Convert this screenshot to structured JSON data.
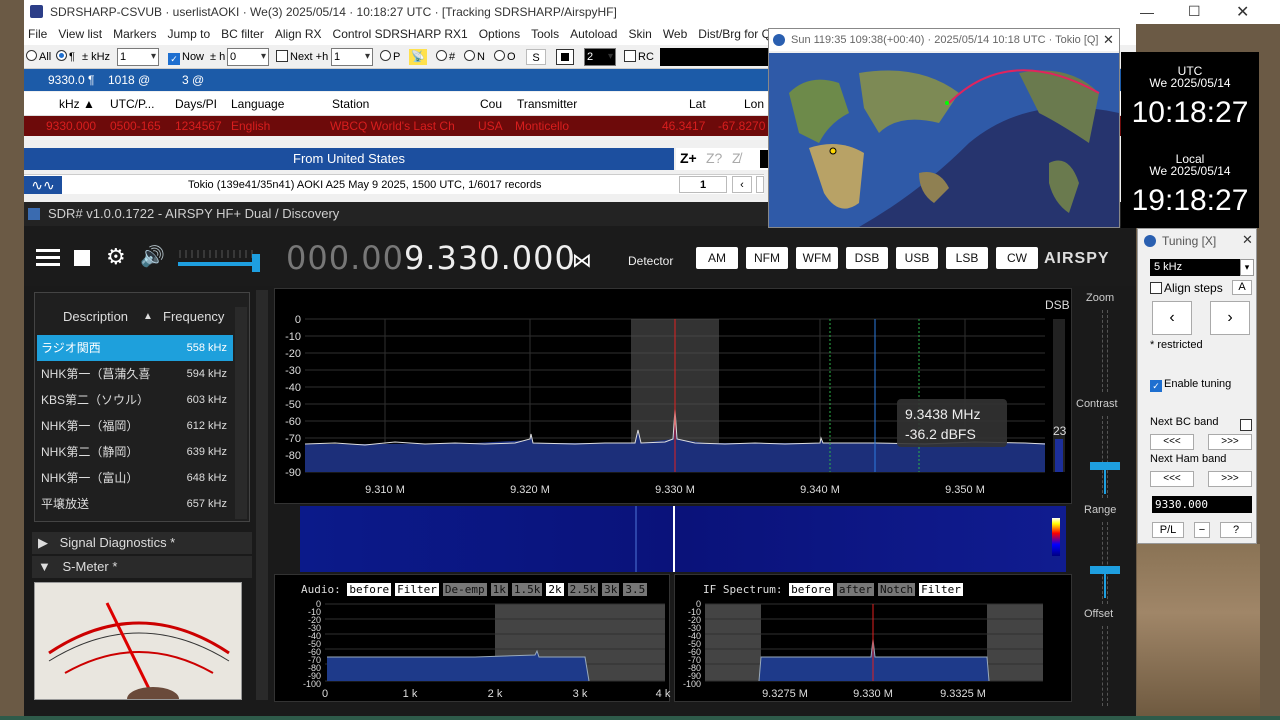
{
  "main": {
    "title": "SDRSHARP-CSVUB · userlistAOKI · We(3) 2025/05/14 · 10:18:27 UTC · [Tracking SDRSHARP/AirspyHF]"
  },
  "menu": [
    "File",
    "View list",
    "Markers",
    "Jump to",
    "BC filter",
    "Align RX",
    "Control SDRSHARP RX1",
    "Options",
    "Tools",
    "Autoload",
    "Skin",
    "Web",
    "Dist/Brg for Q"
  ],
  "controls": {
    "all": "All",
    "pilcrow": "¶",
    "pm_khz": "± kHz",
    "sel1": "1",
    "now": "Now",
    "pm_h": "± h",
    "sel2": "0",
    "next": "Next +h",
    "sel3": "1",
    "p": "P",
    "hash": "#",
    "n": "N",
    "o": "O",
    "s": "S",
    "num": "2",
    "rc": "RC"
  },
  "freqrow": {
    "freq": "9330.0 ¶",
    "count": "1018 @",
    "count2": "3 @"
  },
  "table": {
    "headers": [
      "kHz ▲",
      "UTC/P...",
      "Days/PI",
      "Language",
      "Station",
      "Cou",
      "Transmitter",
      "Lat",
      "Lon"
    ],
    "row": [
      "9330.000",
      "0500-165",
      "1234567",
      "English",
      "WBCQ World's Last Ch",
      "USA",
      "Monticello",
      "46.3417",
      "-67.8270"
    ]
  },
  "from": "From United States",
  "tokio": {
    "info": "Tokio (139e41/35n41) AOKI A25 May 9 2025, 1500 UTC, 1/6017 records",
    "page": "1"
  },
  "sdr": {
    "title": "SDR# v1.0.0.1722 - AIRSPY HF+ Dual / Discovery",
    "freq_dim": "000.00",
    "freq_main": "9.330.000",
    "detector": "Detector",
    "modes": [
      "AM",
      "NFM",
      "WFM",
      "DSB",
      "USB",
      "LSB",
      "CW"
    ],
    "logo": "AIRSPY",
    "list_headers": {
      "desc": "Description",
      "freq": "Frequency"
    },
    "list": [
      [
        "ラジオ関西",
        "558 kHz"
      ],
      [
        "NHK第一（菖蒲久喜",
        "594 kHz"
      ],
      [
        "KBS第二（ソウル）",
        "603 kHz"
      ],
      [
        "NHK第一（福岡）",
        "612 kHz"
      ],
      [
        "NHK第二（静岡）",
        "639 kHz"
      ],
      [
        "NHK第一（富山）",
        "648 kHz"
      ],
      [
        "平壌放送",
        "657 kHz"
      ]
    ],
    "sig_diag": "Signal Diagnostics *",
    "smeter": "S-Meter *",
    "dsb": "DSB",
    "level": "23",
    "tooltip": [
      "9.3438 MHz",
      "-36.2 dBFS"
    ],
    "yaxis": [
      "0",
      "-10",
      "-20",
      "-30",
      "-40",
      "-50",
      "-60",
      "-70",
      "-80",
      "-90"
    ],
    "xaxis": [
      "9.310 M",
      "9.320 M",
      "9.330 M",
      "9.340 M",
      "9.350 M"
    ],
    "zoom": "Zoom",
    "contrast": "Contrast",
    "range": "Range",
    "offset": "Offset",
    "audio": {
      "label": "Audio:",
      "chips": [
        "before",
        "Filter",
        "De-emp",
        "1k",
        "1.5k",
        "2k",
        "2.5k",
        "3k",
        "3.5"
      ],
      "x": [
        "0",
        "1 k",
        "2 k",
        "3 k",
        "4 k"
      ]
    },
    "if": {
      "label": "IF Spectrum:",
      "chips": [
        "before",
        "after",
        "Notch",
        "Filter"
      ],
      "x": [
        "9.3275 M",
        "9.330 M",
        "9.3325 M"
      ]
    },
    "small_y": [
      "0",
      "-10",
      "-20",
      "-30",
      "-40",
      "-50",
      "-60",
      "-70",
      "-80",
      "-90",
      "-100"
    ]
  },
  "map": {
    "title": "Sun 119:35 109:38(+00:40) · 2025/05/14 10:18 UTC · Tokio [Q]"
  },
  "clock": {
    "utc": "UTC",
    "utc_date": "We 2025/05/14",
    "utc_time": "10:18:27",
    "local": "Local",
    "local_date": "We 2025/05/14",
    "local_time": "19:18:27"
  },
  "tuning": {
    "title": "Tuning [X]",
    "step": "5 kHz",
    "align": "Align steps",
    "a": "A",
    "restricted": "* restricted",
    "enable": "Enable tuning",
    "next_bc": "Next BC band",
    "next_ham": "Next Ham band",
    "prev": "<<<",
    "next_b": ">>>",
    "freq": "9330.000",
    "pl": "P/L",
    "minus": "−",
    "q": "?"
  }
}
